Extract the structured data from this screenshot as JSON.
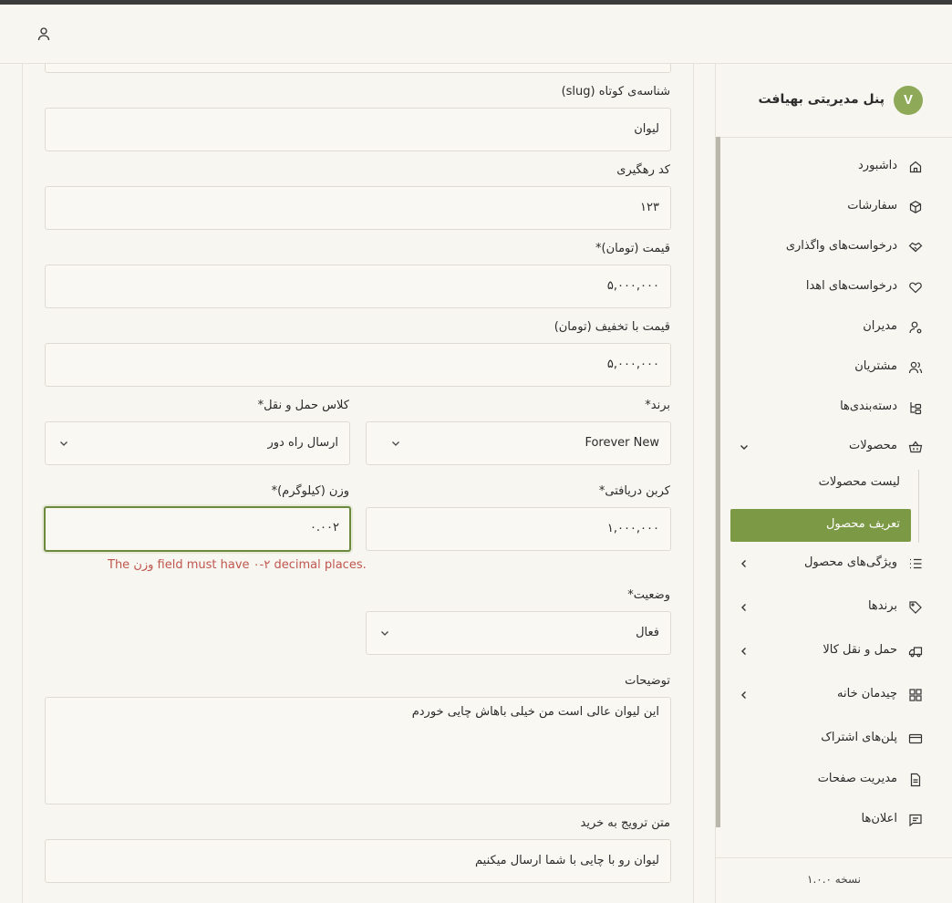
{
  "header": {
    "user_icon": "user-icon"
  },
  "form": {
    "slug": {
      "label": "شناسه‌ی کوتاه (slug)",
      "value": "لیوان"
    },
    "tracking_code": {
      "label": "کد رهگیری",
      "value": "۱۲۳"
    },
    "price": {
      "label": "قیمت (تومان)*",
      "value": "۵,۰۰۰,۰۰۰"
    },
    "discount_price": {
      "label": "قیمت با تخفیف (تومان)",
      "value": "۵,۰۰۰,۰۰۰"
    },
    "brand": {
      "label": "برند*",
      "value": "Forever New"
    },
    "shipping_class": {
      "label": "کلاس حمل و نقل*",
      "value": "ارسال راه دور"
    },
    "carbon": {
      "label": "کربن دریافتی*",
      "value": "۱,۰۰۰,۰۰۰"
    },
    "weight": {
      "label": "وزن (کیلوگرم)*",
      "value": "۰.۰۰۲",
      "error": "The وزن field must have ۰-۲ decimal places."
    },
    "status": {
      "label": "وضعیت*",
      "value": "فعال"
    },
    "description": {
      "label": "توضیحات",
      "value": "این لیوان عالی است من خیلی باهاش چایی خوردم"
    },
    "promo_text": {
      "label": "متن ترویج به خرید",
      "value": "لیوان رو با چایی با شما ارسال میکنیم"
    }
  },
  "sidebar": {
    "brand_logo": "V",
    "brand_title": "پنل مدیریتی بهیافت",
    "items": [
      {
        "label": "داشبورد",
        "icon": "home-icon"
      },
      {
        "label": "سفارشات",
        "icon": "box-icon"
      },
      {
        "label": "درخواست‌های واگذاری",
        "icon": "handshake-icon"
      },
      {
        "label": "درخواست‌های اهدا",
        "icon": "heart-hand-icon"
      },
      {
        "label": "مدیران",
        "icon": "user-cog-icon"
      },
      {
        "label": "مشتریان",
        "icon": "users-icon"
      },
      {
        "label": "دسته‌بندی‌ها",
        "icon": "tree-icon"
      },
      {
        "label": "محصولات",
        "icon": "basket-icon"
      },
      {
        "label": "ویژگی‌های محصول",
        "icon": "list-icon"
      },
      {
        "label": "برندها",
        "icon": "tag-icon"
      },
      {
        "label": "حمل و نقل کالا",
        "icon": "truck-icon"
      },
      {
        "label": "چیدمان خانه",
        "icon": "grid-icon"
      },
      {
        "label": "پلن‌های اشتراک",
        "icon": "card-icon"
      },
      {
        "label": "مدیریت صفحات",
        "icon": "file-icon"
      },
      {
        "label": "اعلان‌ها",
        "icon": "message-icon"
      }
    ],
    "sub_items": [
      "لیست محصولات",
      "تعریف محصول"
    ],
    "version": "نسخه ۱.۰.۰"
  }
}
